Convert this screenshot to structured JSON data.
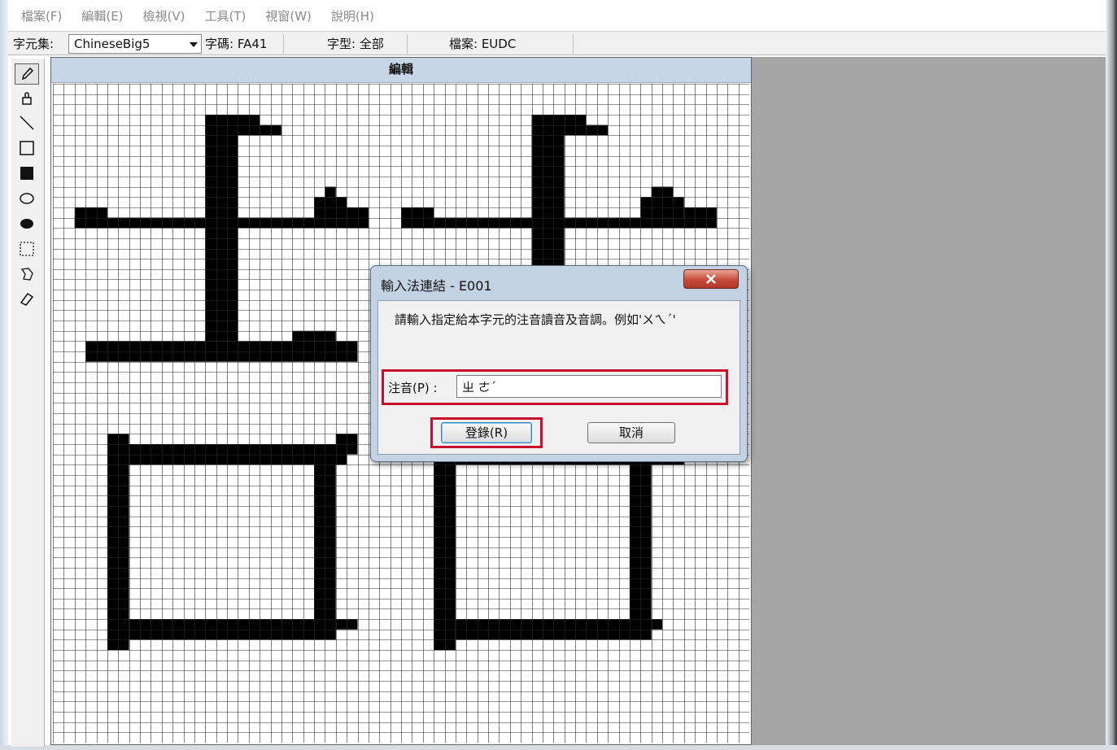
{
  "menu": [
    "檔案(F)",
    "編輯(E)",
    "檢視(V)",
    "工具(T)",
    "視窗(W)",
    "說明(H)"
  ],
  "toolbar": {
    "charset_label": "字元集:",
    "charset_value": "ChineseBig5",
    "code": "字碼: FA41",
    "font": "字型: 全部",
    "file": "檔案: EUDC"
  },
  "tools": [
    "pencil-icon",
    "brush-icon",
    "line-icon",
    "hollow-rectangle-icon",
    "filled-rectangle-icon",
    "hollow-ellipse-icon",
    "filled-ellipse-icon",
    "rectangular-select-icon",
    "freeform-select-icon",
    "eraser-icon"
  ],
  "editor": {
    "title": "編輯",
    "grid": {
      "cols": 64,
      "rows": 64,
      "filled_rects": [
        [
          14,
          3,
          3,
          22
        ],
        [
          14,
          3,
          5,
          2
        ],
        [
          19,
          4,
          2,
          1
        ],
        [
          2,
          12,
          3,
          2
        ],
        [
          2,
          13,
          27,
          1
        ],
        [
          24,
          11,
          3,
          2
        ],
        [
          25,
          10,
          1,
          1
        ],
        [
          27,
          12,
          2,
          2
        ],
        [
          3,
          25,
          25,
          2
        ],
        [
          22,
          24,
          4,
          1
        ],
        [
          5,
          34,
          2,
          21
        ],
        [
          7,
          35,
          20,
          2
        ],
        [
          26,
          34,
          2,
          2
        ],
        [
          24,
          35,
          2,
          19
        ],
        [
          26,
          52,
          2,
          1
        ],
        [
          7,
          52,
          19,
          2
        ],
        [
          44,
          3,
          3,
          22
        ],
        [
          44,
          3,
          5,
          2
        ],
        [
          49,
          4,
          2,
          1
        ],
        [
          32,
          12,
          3,
          2
        ],
        [
          32,
          13,
          27,
          1
        ],
        [
          54,
          11,
          4,
          2
        ],
        [
          55,
          10,
          2,
          1
        ],
        [
          58,
          12,
          3,
          2
        ],
        [
          35,
          25,
          25,
          2
        ],
        [
          35,
          34,
          2,
          21
        ],
        [
          37,
          35,
          20,
          2
        ],
        [
          57,
          35,
          1,
          2
        ],
        [
          53,
          35,
          2,
          19
        ],
        [
          55,
          52,
          1,
          1
        ],
        [
          37,
          52,
          18,
          2
        ]
      ]
    }
  },
  "dialog": {
    "title": "輸入法連結 - E001",
    "prompt": "請輸入指定給本字元的注音讀音及音調。例如'ㄨㄟˊ'",
    "field_label": "注音(P) :",
    "field_value": "ㄓ ㄜˊ",
    "register_label": "登錄(R)",
    "cancel_label": "取消"
  },
  "colors": {
    "highlight": "#c8102e",
    "editor_header": "#c7d6e6",
    "pixel_on": "#000000",
    "right_pane": "#a5a5a5"
  }
}
